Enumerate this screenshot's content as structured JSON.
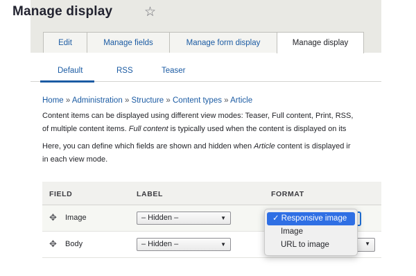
{
  "header": {
    "title": "Manage display",
    "star_icon": "☆"
  },
  "primary_tabs": [
    {
      "label": "Edit",
      "active": false
    },
    {
      "label": "Manage fields",
      "active": false
    },
    {
      "label": "Manage form display",
      "active": false
    },
    {
      "label": "Manage display",
      "active": true
    }
  ],
  "secondary_tabs": [
    {
      "label": "Default",
      "active": true
    },
    {
      "label": "RSS",
      "active": false
    },
    {
      "label": "Teaser",
      "active": false
    }
  ],
  "breadcrumb": {
    "items": [
      "Home",
      "Administration",
      "Structure",
      "Content types",
      "Article"
    ],
    "separator": "»"
  },
  "description": {
    "p1_line1": "Content items can be displayed using different view modes: Teaser, Full content, Print, RSS,",
    "p1_line2_a": "of multiple content items. ",
    "p1_line2_em": "Full content",
    "p1_line2_b": " is typically used when the content is displayed on its",
    "p2_line1_a": "Here, you can define which fields are shown and hidden when ",
    "p2_line1_em": "Article",
    "p2_line1_b": " content is displayed ir",
    "p2_line2": "in each view mode."
  },
  "table": {
    "headers": {
      "field": "FIELD",
      "label": "LABEL",
      "format": "FORMAT"
    },
    "rows": [
      {
        "field": "Image",
        "label_select": "– Hidden –",
        "highlighted": true
      },
      {
        "field": "Body",
        "label_select": "– Hidden –",
        "highlighted": false
      }
    ]
  },
  "format_dropdown": {
    "options": [
      {
        "label": "Responsive image",
        "selected": true
      },
      {
        "label": "Image",
        "selected": false
      },
      {
        "label": "URL to image",
        "selected": false
      }
    ],
    "check": "✓"
  },
  "icons": {
    "drag": "✥",
    "select_arrow": "▼"
  },
  "colors": {
    "link": "#1b5ba3",
    "header_bg": "#e9e9e4",
    "selected_option": "#2f6fe4",
    "focus_ring": "#1f6fd6"
  }
}
